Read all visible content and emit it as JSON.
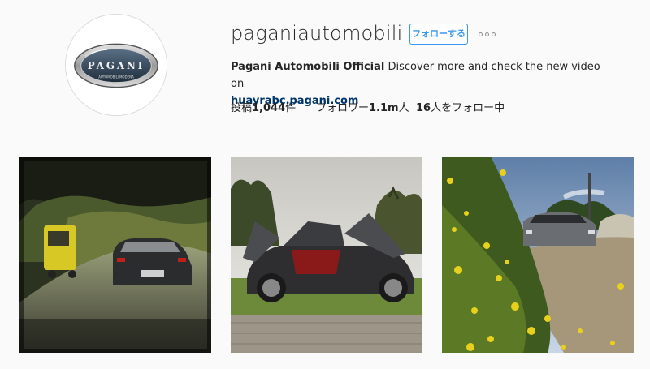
{
  "profile": {
    "username": "paganiautomobili",
    "follow_label": "フォローする",
    "more_icon": "more-options-icon",
    "logo_text": "PAGANI",
    "logo_subtext": "AUTOMOBILI MODENA"
  },
  "bio": {
    "name": "Pagani Automobili Official",
    "text": "Discover more and check the new video on",
    "link": "huayrabc.pagani.com"
  },
  "stats": {
    "posts_prefix": "投稿",
    "posts_count": "1,044",
    "posts_suffix": "件",
    "followers_prefix": "フォロワー",
    "followers_count": "1.1m",
    "followers_suffix": "人",
    "following_count": "16",
    "following_suffix": "人をフォロー中"
  },
  "posts": [
    {
      "subject": "car-and-yellow-tuk-tuk-on-road"
    },
    {
      "subject": "car-with-gullwing-doors-open"
    },
    {
      "subject": "car-on-country-road-with-yellow-flowers"
    }
  ],
  "colors": {
    "accent": "#3897f0",
    "link": "#003569",
    "text": "#262626",
    "background": "#fafafa"
  }
}
